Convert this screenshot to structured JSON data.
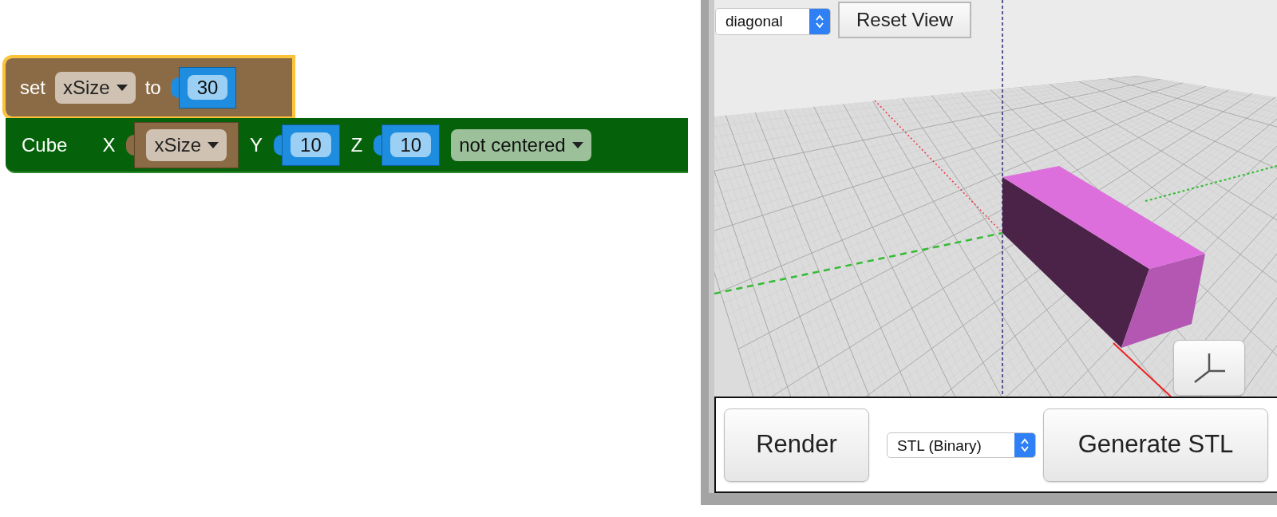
{
  "blocks": [
    {
      "kind": "set",
      "label": "set",
      "variable": "xSize",
      "connector": "to",
      "value": "30",
      "selected": true
    },
    {
      "kind": "cube",
      "label": "Cube",
      "inputs": [
        {
          "kind": "variable",
          "label": "X",
          "value": "xSize"
        },
        {
          "kind": "number",
          "label": "Y",
          "value": "10"
        },
        {
          "kind": "number",
          "label": "Z",
          "value": "10"
        }
      ],
      "centering": "not centered",
      "selected": false
    }
  ],
  "viewport": {
    "view_select": "diagonal",
    "reset_button": "Reset View"
  },
  "controls": {
    "render_button": "Render",
    "format_select": "STL (Binary)",
    "generate_button": "Generate STL"
  }
}
